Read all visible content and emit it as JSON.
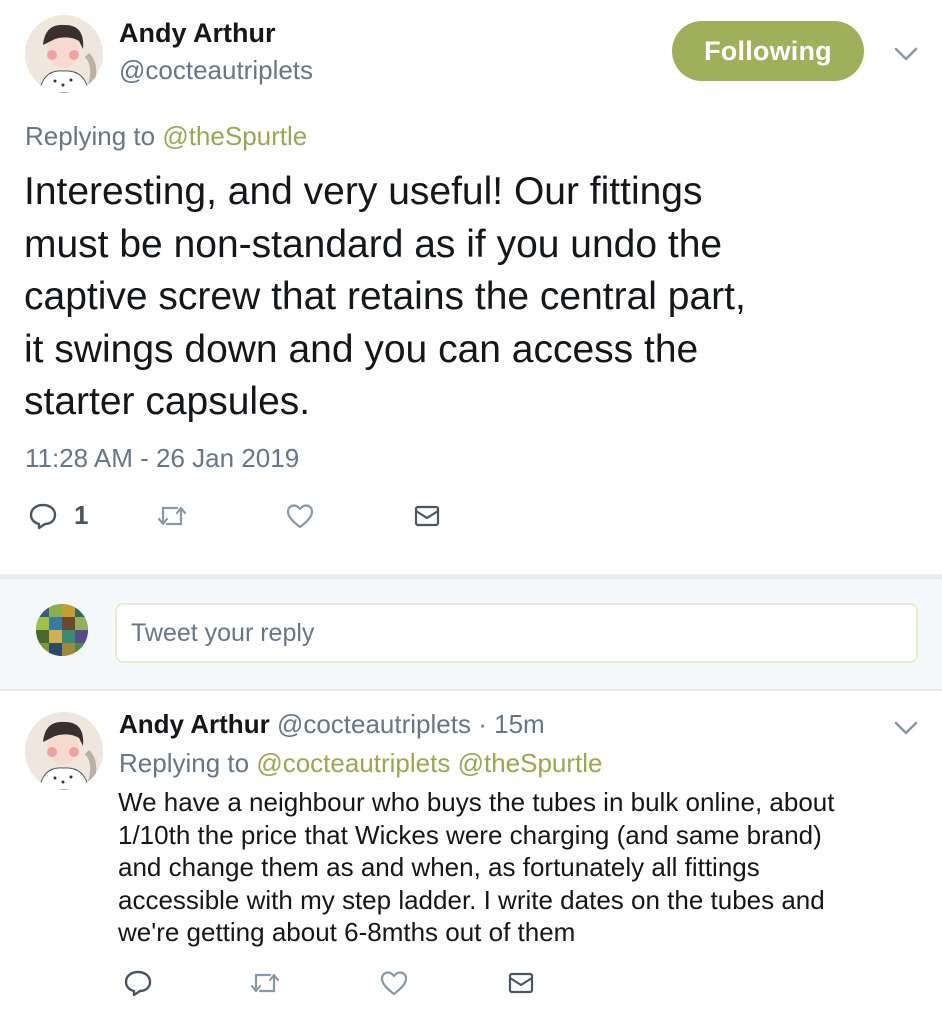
{
  "main_tweet": {
    "author_name": "Andy Arthur",
    "author_handle": "@cocteautriplets",
    "follow_label": "Following",
    "replying_prefix": "Replying to",
    "replying_handle": "@theSpurtle",
    "text_lines": [
      "Interesting, and very useful! Our fittings",
      "must be non-standard as if you undo the",
      "captive screw that retains the central part,",
      "it swings down and you can access the",
      "starter capsules."
    ],
    "timestamp": "11:28 AM - 26 Jan 2019",
    "reply_count": "1"
  },
  "reply_box": {
    "placeholder": "Tweet your reply"
  },
  "reply_tweet": {
    "author_name": "Andy Arthur",
    "author_handle": "@cocteautriplets",
    "separator": "·",
    "time": "15m",
    "replying_prefix": "Replying to",
    "replying_handles": [
      "@cocteautriplets",
      "@theSpurtle"
    ],
    "text_lines": [
      "We have a neighbour who buys the tubes in bulk online, about",
      "1/10th the price that Wickes were charging (and same brand)",
      "and change them as and when, as fortunately all fittings",
      "accessible with my step ladder. I write dates on the tubes and",
      "we're getting about 6-8mths out of them"
    ]
  },
  "colors": {
    "accent": "#96a94f",
    "follow_button": "#a0b05a",
    "muted_text": "#657786",
    "divider": "#e6ecf0"
  },
  "icons": [
    "chevron-down-icon",
    "reply-icon",
    "retweet-icon",
    "like-icon",
    "dm-icon"
  ]
}
